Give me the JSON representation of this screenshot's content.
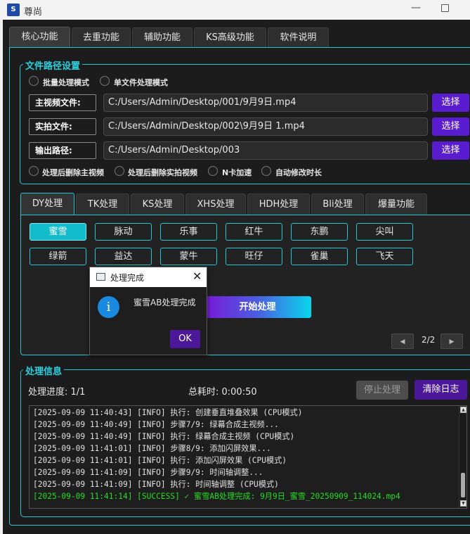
{
  "window": {
    "title": "尊尚"
  },
  "main_tabs": [
    {
      "label": "核心功能"
    },
    {
      "label": "去重功能"
    },
    {
      "label": "辅助功能"
    },
    {
      "label": "KS高级功能"
    },
    {
      "label": "软件说明"
    }
  ],
  "file_paths": {
    "group_title": "文件路径设置",
    "mode_batch": "批量处理模式",
    "mode_single": "单文件处理模式",
    "main_video_label": "主视频文件:",
    "main_video_value": "C:/Users/Admin/Desktop/001/9月9日.mp4",
    "shot_label": "实拍文件:",
    "shot_value": "C:/Users/Admin/Desktop/002\\9月9日  1.mp4",
    "output_label": "输出路径:",
    "output_value": "C:/Users/Admin/Desktop/003",
    "choose_label": "选择",
    "options": [
      {
        "label": "处理后删除主视频"
      },
      {
        "label": "处理后删除实拍视频"
      },
      {
        "label": "N卡加速"
      },
      {
        "label": "自动修改时长"
      }
    ]
  },
  "sub_tabs": [
    {
      "label": "DY处理"
    },
    {
      "label": "TK处理"
    },
    {
      "label": "KS处理"
    },
    {
      "label": "XHS处理"
    },
    {
      "label": "HDH处理"
    },
    {
      "label": "Bli处理"
    },
    {
      "label": "爆量功能"
    }
  ],
  "feature_buttons": [
    {
      "label": "蜜雪"
    },
    {
      "label": "脉动"
    },
    {
      "label": "乐事"
    },
    {
      "label": "红牛"
    },
    {
      "label": "东鹏"
    },
    {
      "label": "尖叫"
    },
    {
      "label": "绿箭"
    },
    {
      "label": "益达"
    },
    {
      "label": "蒙牛"
    },
    {
      "label": "旺仔"
    },
    {
      "label": "雀巢"
    },
    {
      "label": "飞天"
    }
  ],
  "selected_feature": "蜜雪",
  "start_button": "开始处理",
  "pagination": {
    "page": "2/2"
  },
  "dialog": {
    "title": "处理完成",
    "message": "蜜雪AB处理完成",
    "ok": "OK",
    "icon": "i"
  },
  "processing_info": {
    "group_title": "处理信息",
    "progress": "处理进度: 1/1",
    "elapsed": "总耗时: 0:00:50",
    "stop_button": "停止处理",
    "clear_button": "清除日志"
  },
  "log": [
    {
      "text": "[2025-09-09 11:40:43] [INFO] 执行: 创建垂直堆叠效果 (CPU模式)",
      "type": "info"
    },
    {
      "text": "[2025-09-09 11:40:49] [INFO] 步骤7/9: 绿幕合成主视频...",
      "type": "info"
    },
    {
      "text": "[2025-09-09 11:40:49] [INFO] 执行: 绿幕合成主视频 (CPU模式)",
      "type": "info"
    },
    {
      "text": "[2025-09-09 11:41:01] [INFO] 步骤8/9: 添加闪屏效果...",
      "type": "info"
    },
    {
      "text": "[2025-09-09 11:41:01] [INFO] 执行: 添加闪屏效果 (CPU模式)",
      "type": "info"
    },
    {
      "text": "[2025-09-09 11:41:09] [INFO] 步骤9/9: 时间轴调整...",
      "type": "info"
    },
    {
      "text": "[2025-09-09 11:41:09] [INFO] 执行: 时间轴调整 (CPU模式)",
      "type": "info"
    },
    {
      "text": "[2025-09-09 11:41:14] [SUCCESS] ✓ 蜜雪AB处理完成: 9月9日_蜜雪_20250909_114024.mp4",
      "type": "success"
    }
  ],
  "colors": {
    "accent_cyan": "#22c6d4",
    "button_purple": "#5a1ccf",
    "success_green": "#22dd22",
    "selected_feature": "#12bccb"
  },
  "icons": {
    "app": "app-logo-icon",
    "dialog": "window-icon",
    "info": "info-icon",
    "close": "close-icon"
  }
}
